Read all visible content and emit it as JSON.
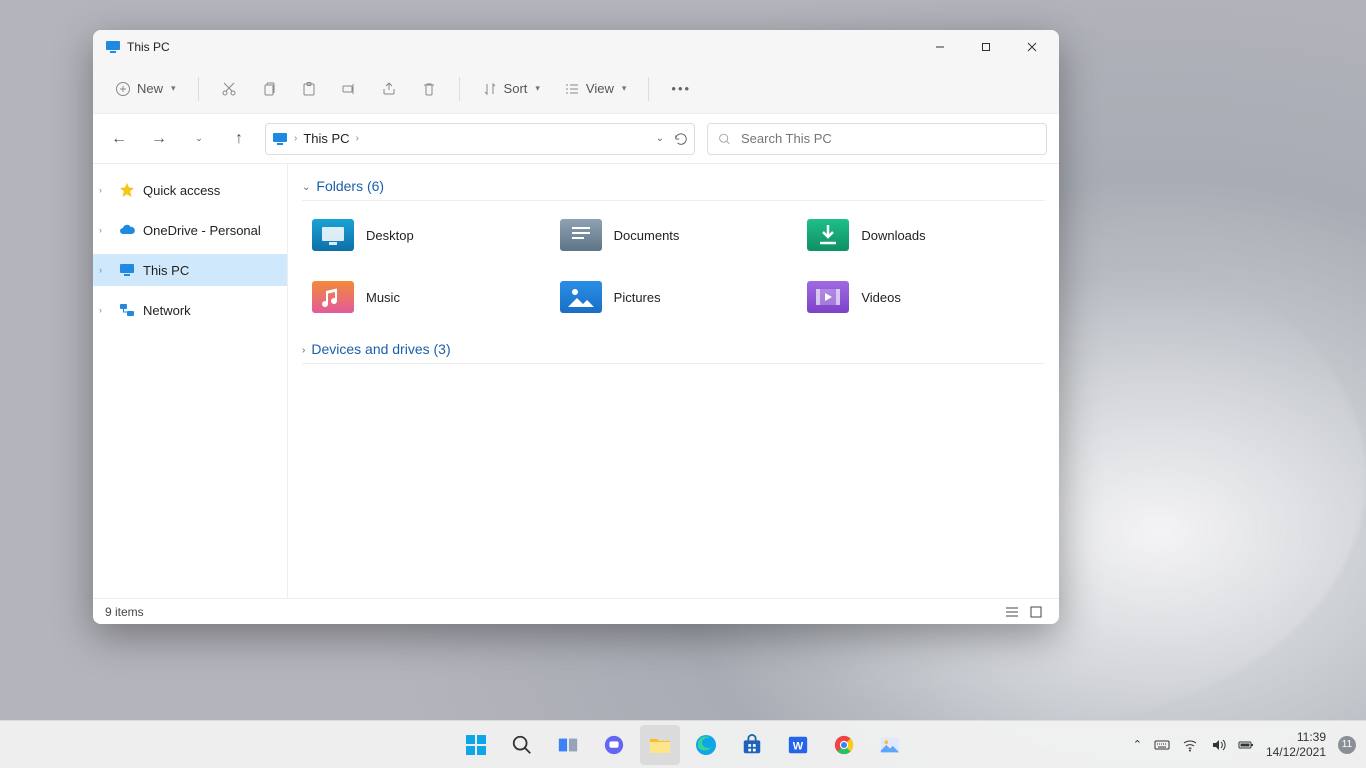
{
  "window": {
    "title": "This PC",
    "toolbar": {
      "new_label": "New",
      "sort_label": "Sort",
      "view_label": "View"
    },
    "breadcrumb": {
      "root": "This PC"
    },
    "search_placeholder": "Search This PC",
    "sidebar": {
      "items": [
        {
          "label": "Quick access",
          "icon": "star",
          "color": "#f5c518"
        },
        {
          "label": "OneDrive - Personal",
          "icon": "cloud",
          "color": "#1f8ae0"
        },
        {
          "label": "This PC",
          "icon": "monitor",
          "color": "#1f8ae0",
          "active": true
        },
        {
          "label": "Network",
          "icon": "network",
          "color": "#1f8ae0"
        }
      ]
    },
    "sections": {
      "folders_label": "Folders (6)",
      "folders": [
        {
          "label": "Desktop",
          "icon": "desktop",
          "grad": [
            "#1aa2d6",
            "#0e6fa8"
          ]
        },
        {
          "label": "Documents",
          "icon": "documents",
          "grad": [
            "#8fa2b3",
            "#5e7487"
          ]
        },
        {
          "label": "Downloads",
          "icon": "downloads",
          "grad": [
            "#1fbf88",
            "#0f8f65"
          ]
        },
        {
          "label": "Music",
          "icon": "music",
          "grad": [
            "#f28a3a",
            "#e25b9b"
          ]
        },
        {
          "label": "Pictures",
          "icon": "pictures",
          "grad": [
            "#2a8ee6",
            "#1a6fc4"
          ]
        },
        {
          "label": "Videos",
          "icon": "videos",
          "grad": [
            "#a06be0",
            "#7d42c9"
          ]
        }
      ],
      "devices_label": "Devices and drives (3)"
    },
    "status": {
      "items": "9 items"
    }
  },
  "taskbar": {
    "apps": [
      "start",
      "search",
      "taskview",
      "chat",
      "explorer",
      "edge",
      "store",
      "word",
      "chrome",
      "photos"
    ]
  },
  "tray": {
    "time": "11:39",
    "date": "14/12/2021",
    "notifications": "11"
  }
}
